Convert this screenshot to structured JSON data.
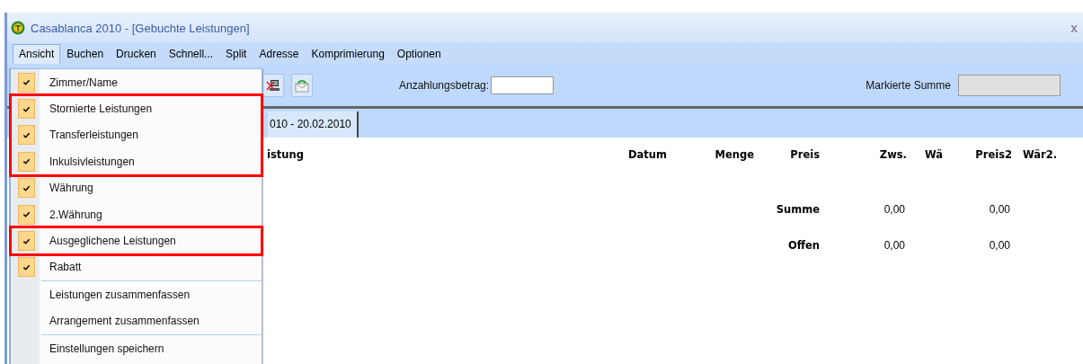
{
  "window": {
    "title": "Casablanca 2010 - [Gebuchte Leistungen]",
    "close": "x"
  },
  "menubar": [
    {
      "label": "Ansicht",
      "selected": true
    },
    {
      "label": "Buchen",
      "selected": false
    },
    {
      "label": "Drucken",
      "selected": false
    },
    {
      "label": "Schnell...",
      "selected": false
    },
    {
      "label": "Split",
      "selected": false
    },
    {
      "label": "Adresse",
      "selected": false
    },
    {
      "label": "Komprimierung",
      "selected": false
    },
    {
      "label": "Optionen",
      "selected": false
    }
  ],
  "toolbar": {
    "deposit_label": "Anzahlungsbetrag:",
    "marked_sum_label": "Markierte Summe"
  },
  "tab": {
    "label": "010 - 20.02.2010"
  },
  "table": {
    "columns": [
      "istung",
      "Datum",
      "Menge",
      "Preis",
      "Zws.",
      "Wä",
      "Preis2",
      "Wär2."
    ],
    "totals": [
      {
        "label": "Summe",
        "value": "0,00",
        "value2": "0,00"
      },
      {
        "label": "Offen",
        "value": "0,00",
        "value2": "0,00"
      }
    ]
  },
  "menu": {
    "sections": [
      {
        "items": [
          {
            "label": "Zimmer/Name",
            "checked": true,
            "highlighted": false
          },
          {
            "label": "Stornierte Leistungen",
            "checked": true,
            "highlighted": true
          },
          {
            "label": "Transferleistungen",
            "checked": true,
            "highlighted": true
          },
          {
            "label": "Inkulsivleistungen",
            "checked": true,
            "highlighted": true
          },
          {
            "label": "Währung",
            "checked": true,
            "highlighted": false
          },
          {
            "label": "2.Währung",
            "checked": true,
            "highlighted": false
          },
          {
            "label": "Ausgeglichene Leistungen",
            "checked": true,
            "highlighted": true
          },
          {
            "label": "Rabatt",
            "checked": true,
            "highlighted": false
          }
        ]
      },
      {
        "items": [
          {
            "label": "Leistungen zusammenfassen",
            "checked": false,
            "highlighted": false
          },
          {
            "label": "Arrangement zusammenfassen",
            "checked": false,
            "highlighted": false
          }
        ]
      },
      {
        "items": [
          {
            "label": "Einstellungen speichern",
            "checked": false,
            "highlighted": false
          }
        ]
      }
    ]
  }
}
